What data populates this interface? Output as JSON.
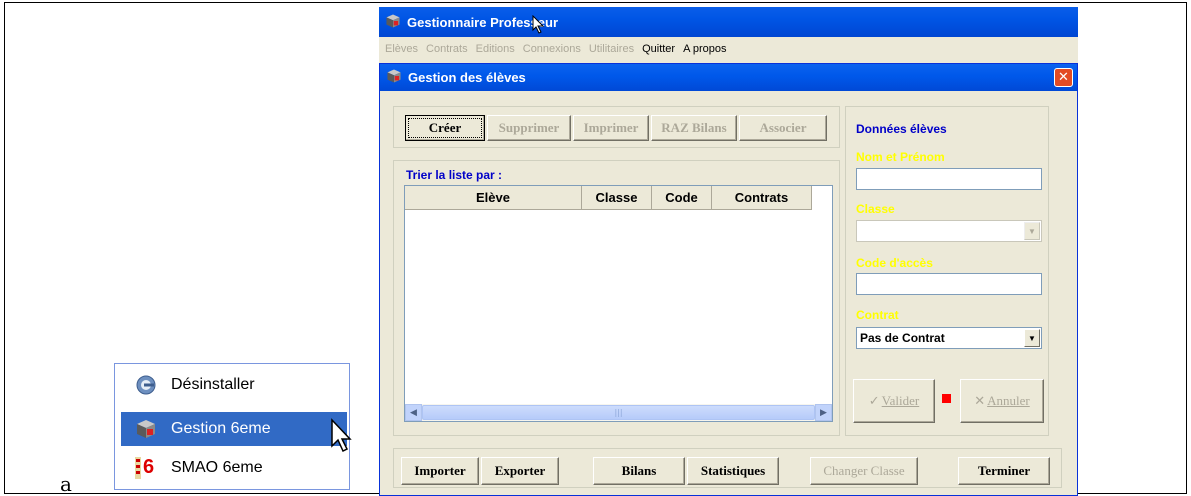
{
  "figure_label": "a",
  "start_menu": {
    "items": [
      {
        "label": "Désinstaller",
        "icon": "uninstall-icon",
        "highlighted": false
      },
      {
        "label": "Gestion 6eme",
        "icon": "app-cube-icon",
        "highlighted": true
      },
      {
        "label": "SMAO 6eme",
        "icon": "smao-6-icon",
        "icon_text": "6",
        "highlighted": false
      }
    ]
  },
  "app": {
    "title": "Gestionnaire Professeur",
    "menu": [
      {
        "label": "Elèves",
        "enabled": false
      },
      {
        "label": "Contrats",
        "enabled": false
      },
      {
        "label": "Editions",
        "enabled": false
      },
      {
        "label": "Connexions",
        "enabled": false
      },
      {
        "label": "Utilitaires",
        "enabled": false
      },
      {
        "label": "Quitter",
        "enabled": true
      },
      {
        "label": "A propos",
        "enabled": true
      }
    ]
  },
  "child": {
    "title": "Gestion des élèves",
    "close_label": "✕",
    "toolbar": {
      "create": "Créer",
      "delete": "Supprimer",
      "print": "Imprimer",
      "reset": "RAZ Bilans",
      "associate": "Associer"
    },
    "sort_label": "Trier la liste par :",
    "columns": [
      "Elève",
      "Classe",
      "Code",
      "Contrats"
    ],
    "rows": [],
    "details": {
      "heading": "Données élèves",
      "name_label": "Nom et Prénom",
      "name_value": "",
      "class_label": "Classe",
      "class_value": "",
      "access_label": "Code d'accès",
      "access_value": "",
      "contract_label": "Contrat",
      "contract_value": "Pas de Contrat",
      "validate": "Valider",
      "cancel": "Annuler"
    },
    "footer": {
      "import": "Importer",
      "export": "Exporter",
      "reports": "Bilans",
      "stats": "Statistiques",
      "change_class": "Changer Classe",
      "finish": "Terminer"
    }
  },
  "colors": {
    "title_blue": "#0055e5",
    "heading_blue": "#0000c8",
    "field_label_yellow": "#ffff00",
    "selection_blue": "#316ac5"
  }
}
